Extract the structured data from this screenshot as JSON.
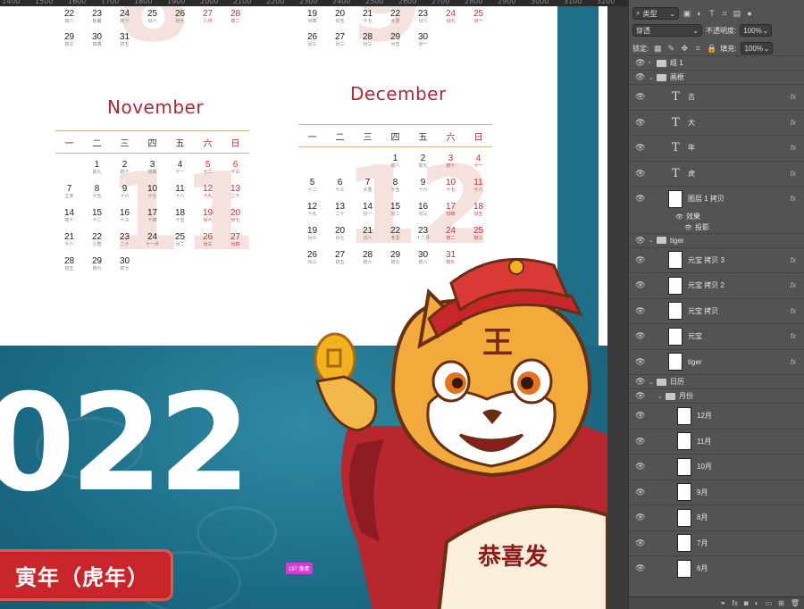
{
  "ruler": {
    "marks": [
      "1400",
      "1500",
      "1600",
      "1700",
      "1800",
      "1900",
      "2000",
      "2100",
      "2200",
      "2300",
      "2400",
      "2500",
      "2600",
      "2700",
      "2800",
      "2900",
      "3000",
      "3100",
      "3200"
    ]
  },
  "top_rows": {
    "left": [
      [
        {
          "d": "22",
          "l": "初八"
        },
        {
          "d": "23",
          "l": "处暑"
        },
        {
          "d": "24",
          "l": "初十"
        },
        {
          "d": "25",
          "l": "廿八"
        },
        {
          "d": "26",
          "l": "廿九"
        },
        {
          "d": "27",
          "l": "八月",
          "red": true
        },
        {
          "d": "28",
          "l": "初二",
          "red": true
        }
      ],
      [
        {
          "d": "29",
          "l": "初三"
        },
        {
          "d": "30",
          "l": "初四"
        },
        {
          "d": "31",
          "l": "初五"
        }
      ]
    ],
    "right": [
      [
        {
          "d": "19",
          "l": "廿四"
        },
        {
          "d": "20",
          "l": "廿五"
        },
        {
          "d": "21",
          "l": "十七"
        },
        {
          "d": "22",
          "l": "大雪"
        },
        {
          "d": "23",
          "l": "廿八"
        },
        {
          "d": "24",
          "l": "廿九",
          "red": true
        },
        {
          "d": "25",
          "l": "廿一",
          "red": true
        }
      ],
      [
        {
          "d": "26",
          "l": "廿三"
        },
        {
          "d": "27",
          "l": "廿三"
        },
        {
          "d": "28",
          "l": "廿三"
        },
        {
          "d": "29",
          "l": "廿五"
        },
        {
          "d": "30",
          "l": "廿一"
        }
      ]
    ]
  },
  "weekdays": [
    "一",
    "二",
    "三",
    "四",
    "五",
    "六",
    "日"
  ],
  "november": {
    "title": "November",
    "big": "11",
    "rows": [
      [
        null,
        null,
        null,
        {
          "d": "3",
          "l": "初四"
        },
        {
          "d": "4",
          "l": "十一"
        },
        {
          "d": "5",
          "l": "十二",
          "red": true
        },
        {
          "d": "6",
          "l": "十三",
          "red": true
        }
      ],
      [
        {
          "d": "7",
          "l": "立冬"
        },
        {
          "d": "8",
          "l": "十五"
        },
        {
          "d": "9",
          "l": "十六"
        },
        {
          "d": "10",
          "l": "十七"
        },
        {
          "d": "11",
          "l": "十八"
        },
        {
          "d": "12",
          "l": "十九",
          "red": true
        },
        {
          "d": "13",
          "l": "二十",
          "red": true
        }
      ],
      [
        {
          "d": "14",
          "l": "初十"
        },
        {
          "d": "15",
          "l": "十二"
        },
        {
          "d": "16",
          "l": "十三"
        },
        {
          "d": "17",
          "l": "十四"
        },
        {
          "d": "18",
          "l": "十五"
        },
        {
          "d": "19",
          "l": "廿六",
          "red": true
        },
        {
          "d": "20",
          "l": "廿七",
          "red": true
        }
      ],
      [
        {
          "d": "21",
          "l": "十八"
        },
        {
          "d": "22",
          "l": "小雪"
        },
        {
          "d": "23",
          "l": "二十"
        },
        {
          "d": "24",
          "l": "十一月"
        },
        {
          "d": "25",
          "l": "廿二"
        },
        {
          "d": "26",
          "l": "廿三",
          "red": true
        },
        {
          "d": "27",
          "l": "廿四",
          "red": true
        }
      ],
      [
        {
          "d": "28",
          "l": "初五"
        },
        {
          "d": "29",
          "l": "初六"
        },
        {
          "d": "30",
          "l": "初七"
        }
      ]
    ],
    "first_row_extra": [
      {
        "d": "1",
        "l": "初九"
      },
      {
        "d": "2",
        "l": "初十"
      }
    ]
  },
  "december": {
    "title": "December",
    "big": "12",
    "rows": [
      [
        null,
        null,
        null,
        {
          "d": "1",
          "l": "初八"
        },
        {
          "d": "2",
          "l": "初九"
        },
        {
          "d": "3",
          "l": "初十",
          "red": true
        },
        {
          "d": "4",
          "l": "十一",
          "red": true
        }
      ],
      [
        {
          "d": "5",
          "l": "十二"
        },
        {
          "d": "6",
          "l": "十三"
        },
        {
          "d": "7",
          "l": "大雪"
        },
        {
          "d": "8",
          "l": "十五"
        },
        {
          "d": "9",
          "l": "十六"
        },
        {
          "d": "10",
          "l": "十七",
          "red": true
        },
        {
          "d": "11",
          "l": "十八",
          "red": true
        }
      ],
      [
        {
          "d": "12",
          "l": "十九"
        },
        {
          "d": "13",
          "l": "二十"
        },
        {
          "d": "14",
          "l": "廿一"
        },
        {
          "d": "15",
          "l": "廿二"
        },
        {
          "d": "16",
          "l": "廿三"
        },
        {
          "d": "17",
          "l": "廿四",
          "red": true
        },
        {
          "d": "18",
          "l": "廿五",
          "red": true
        }
      ],
      [
        {
          "d": "19",
          "l": "廿六"
        },
        {
          "d": "20",
          "l": "廿七"
        },
        {
          "d": "21",
          "l": "廿八"
        },
        {
          "d": "22",
          "l": "冬至"
        },
        {
          "d": "23",
          "l": "十二月"
        },
        {
          "d": "24",
          "l": "初二",
          "red": true
        },
        {
          "d": "25",
          "l": "初三",
          "red": true
        }
      ],
      [
        {
          "d": "26",
          "l": "廿三"
        },
        {
          "d": "27",
          "l": "初五"
        },
        {
          "d": "28",
          "l": "初六"
        },
        {
          "d": "29",
          "l": "初七"
        },
        {
          "d": "30",
          "l": "初八"
        },
        {
          "d": "31",
          "l": "初九",
          "red": true
        }
      ]
    ]
  },
  "poster": {
    "year": "022",
    "banner": "寅年（虎年）",
    "fan_text": "恭喜发",
    "hat_char": "王"
  },
  "measure_badge": "197 像素",
  "panel": {
    "filter_label": "类型",
    "blend_mode": "穿透",
    "opacity_label": "不透明度:",
    "opacity_value": "100%",
    "lock_label": "锁定:",
    "fill_label": "填充:",
    "fill_value": "100%",
    "layers": [
      {
        "name": "组 1",
        "kind": "group",
        "indent": 0,
        "collapsed": true,
        "fx": false
      },
      {
        "name": "画框",
        "kind": "group",
        "indent": 0,
        "collapsed": false,
        "fx": false
      },
      {
        "name": "吉",
        "kind": "text",
        "indent": 1,
        "fx": true
      },
      {
        "name": "大",
        "kind": "text",
        "indent": 1,
        "fx": true
      },
      {
        "name": "年",
        "kind": "text",
        "indent": 1,
        "fx": true
      },
      {
        "name": "虎",
        "kind": "text",
        "indent": 1,
        "fx": true
      },
      {
        "name": "图层 1 拷贝",
        "kind": "image",
        "indent": 1,
        "fx": true,
        "effects": [
          "效果",
          "投影"
        ]
      },
      {
        "name": "tiger",
        "kind": "group",
        "indent": 0,
        "collapsed": false,
        "fx": false
      },
      {
        "name": "元宝 拷贝 3",
        "kind": "image",
        "indent": 1,
        "fx": true
      },
      {
        "name": "元宝 拷贝 2",
        "kind": "image",
        "indent": 1,
        "fx": true
      },
      {
        "name": "元宝 拷贝",
        "kind": "image",
        "indent": 1,
        "fx": true
      },
      {
        "name": "元宝",
        "kind": "image",
        "indent": 1,
        "fx": true
      },
      {
        "name": "tiger",
        "kind": "image",
        "indent": 1,
        "fx": true
      },
      {
        "name": "日历",
        "kind": "group",
        "indent": 0,
        "collapsed": false,
        "fx": false
      },
      {
        "name": "月份",
        "kind": "group",
        "indent": 1,
        "collapsed": false,
        "fx": false
      },
      {
        "name": "12月",
        "kind": "image",
        "indent": 2,
        "fx": false
      },
      {
        "name": "11月",
        "kind": "image",
        "indent": 2,
        "fx": false
      },
      {
        "name": "10月",
        "kind": "image",
        "indent": 2,
        "fx": false
      },
      {
        "name": "9月",
        "kind": "image",
        "indent": 2,
        "fx": false
      },
      {
        "name": "8月",
        "kind": "image",
        "indent": 2,
        "fx": false
      },
      {
        "name": "7月",
        "kind": "image",
        "indent": 2,
        "fx": false
      },
      {
        "name": "6月",
        "kind": "image",
        "indent": 2,
        "fx": false
      }
    ]
  }
}
